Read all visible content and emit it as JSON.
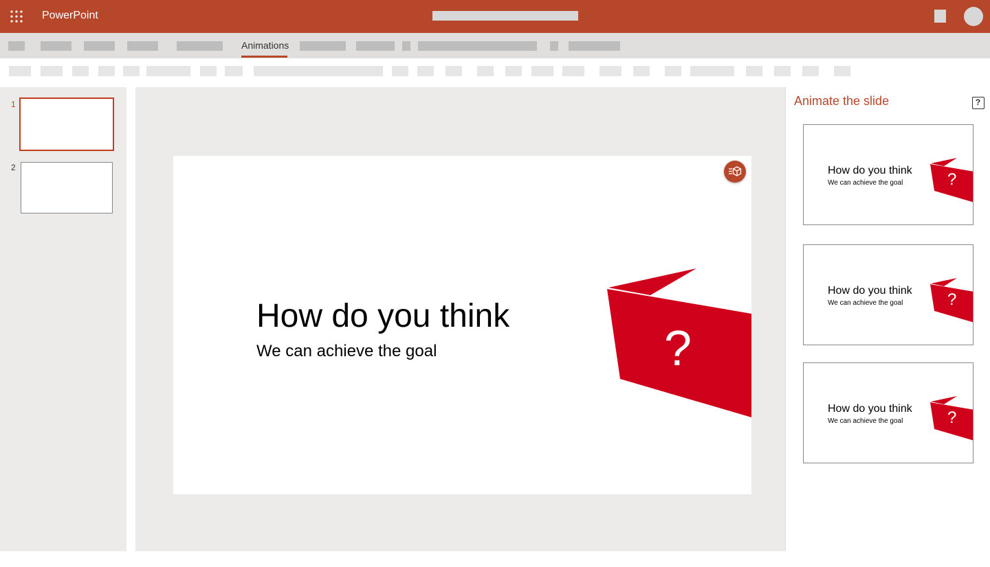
{
  "titlebar": {
    "app_name": "PowerPoint",
    "icon": "app-launcher-icon",
    "background": "#b7472a"
  },
  "tabs": {
    "active_label": "Animations",
    "accent": "#b7472a"
  },
  "thumbnails": {
    "items": [
      {
        "number": "1",
        "selected": true
      },
      {
        "number": "2",
        "selected": false
      }
    ]
  },
  "slide": {
    "title": "How do you think",
    "subtitle": "We can achieve the goal",
    "badge": "?",
    "accent": "#d0021b",
    "designer_icon": "designer-ideas-icon"
  },
  "side_panel": {
    "title": "Animate the slide",
    "help_icon": "help-icon",
    "help_label": "?",
    "options": [
      {
        "title": "How do you think",
        "subtitle": "We can achieve the goal",
        "badge": "?"
      },
      {
        "title": "How do you think",
        "subtitle": "We can achieve the goal",
        "badge": "?"
      },
      {
        "title": "How do you think",
        "subtitle": "We can achieve the goal",
        "badge": "?"
      }
    ]
  }
}
